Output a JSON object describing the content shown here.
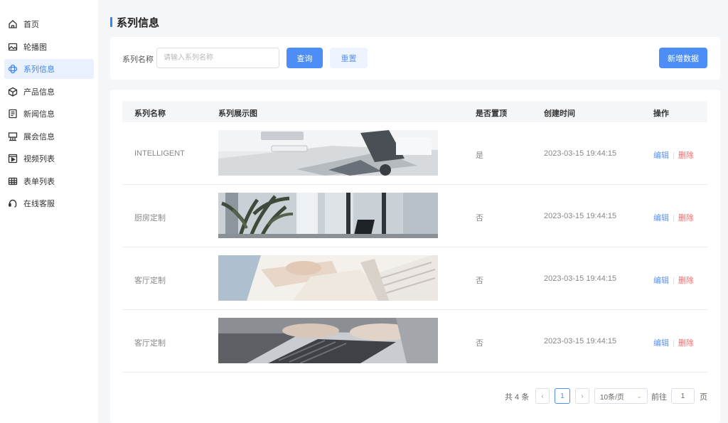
{
  "sidebar": {
    "items": [
      {
        "label": "首页",
        "icon": "home-icon"
      },
      {
        "label": "轮播图",
        "icon": "image-icon"
      },
      {
        "label": "系列信息",
        "icon": "series-icon",
        "active": true
      },
      {
        "label": "产品信息",
        "icon": "cube-icon"
      },
      {
        "label": "新闻信息",
        "icon": "news-icon"
      },
      {
        "label": "展会信息",
        "icon": "exhibition-icon"
      },
      {
        "label": "视频列表",
        "icon": "video-icon"
      },
      {
        "label": "表单列表",
        "icon": "form-icon"
      },
      {
        "label": "在线客服",
        "icon": "headset-icon"
      }
    ]
  },
  "page": {
    "title": "系列信息"
  },
  "filter": {
    "label": "系列名称",
    "placeholder": "请输入系列名称",
    "query_label": "查询",
    "reset_label": "重置",
    "add_label": "新增数据"
  },
  "table": {
    "headers": [
      "系列名称",
      "系列展示图",
      "是否置顶",
      "创建时间",
      "操作"
    ],
    "rows": [
      {
        "name": "INTELLIGENT",
        "pinned": "是",
        "created": "2023-03-15 19:44:15",
        "image": "laptop-desk"
      },
      {
        "name": "厨房定制",
        "pinned": "否",
        "created": "2023-03-15 19:44:15",
        "image": "office-plant"
      },
      {
        "name": "客厅定制",
        "pinned": "否",
        "created": "2023-03-15 19:44:15",
        "image": "hand-writing"
      },
      {
        "name": "客厅定制",
        "pinned": "否",
        "created": "2023-03-15 19:44:15",
        "image": "typing-keyboard"
      }
    ],
    "edit_label": "编辑",
    "delete_label": "删除"
  },
  "pagination": {
    "total_text": "共 4 条",
    "current_page": "1",
    "page_size": "10条/页",
    "goto_label": "前往",
    "goto_value": "1",
    "page_unit": "页"
  },
  "colors": {
    "accent": "#4c8df6",
    "danger": "#f56c6c",
    "active_bg": "#e9f1ff"
  }
}
